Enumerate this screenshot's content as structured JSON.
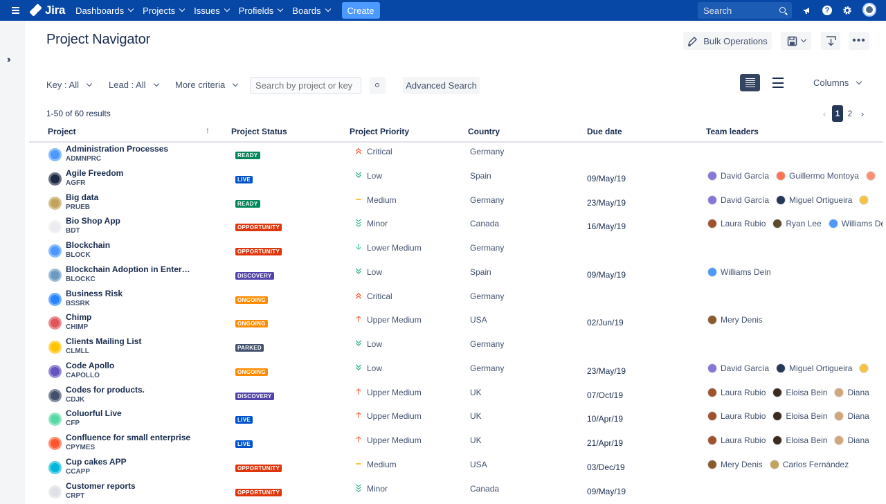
{
  "nav": {
    "logo": "Jira",
    "items": [
      "Dashboards",
      "Projects",
      "Issues",
      "Profields",
      "Boards"
    ],
    "create": "Create",
    "search_placeholder": "Search"
  },
  "page": {
    "title": "Project Navigator",
    "bulk_operations": "Bulk Operations"
  },
  "filters": {
    "key": "Key : All",
    "lead": "Lead : All",
    "more": "More criteria",
    "search_placeholder": "Search by project or key",
    "advanced": "Advanced Search",
    "columns": "Columns"
  },
  "results": "1-50 of 60 results",
  "pagination": {
    "current": "1",
    "next_page": "2"
  },
  "table": {
    "headers": {
      "project": "Project",
      "status": "Project Status",
      "priority": "Project Priority",
      "country": "Country",
      "due": "Due date",
      "leaders": "Team leaders"
    },
    "rows": [
      {
        "name": "Administration Processes",
        "key": "ADMNPRC",
        "status": "READY",
        "status_color": "#00875a",
        "priority": "Critical",
        "prio_type": "critical",
        "country": "Germany",
        "due": "",
        "icon_color": "#4c9aff",
        "leaders": []
      },
      {
        "name": "Agile Freedom",
        "key": "AGFR",
        "status": "LIVE",
        "status_color": "#0052cc",
        "priority": "Low",
        "prio_type": "low",
        "country": "Spain",
        "due": "09/May/19",
        "icon_color": "#1f2a44",
        "leaders": [
          {
            "name": "David García",
            "color": "#8777d9"
          },
          {
            "name": "Guillermo Montoya",
            "color": "#ff7452"
          },
          {
            "name": "",
            "color": "#ff8f73"
          }
        ]
      },
      {
        "name": "Big data",
        "key": "PRUEB",
        "status": "READY",
        "status_color": "#00875a",
        "priority": "Medium",
        "prio_type": "medium",
        "country": "Germany",
        "due": "23/May/19",
        "icon_color": "#c1a35a",
        "leaders": [
          {
            "name": "David García",
            "color": "#8777d9"
          },
          {
            "name": "Miguel Ortigueira",
            "color": "#253858"
          },
          {
            "name": "",
            "color": "#f6c343"
          }
        ]
      },
      {
        "name": "Bio Shop App",
        "key": "BDT",
        "status": "OPPORTUNITY",
        "status_color": "#de350b",
        "priority": "Minor",
        "prio_type": "minor",
        "country": "Canada",
        "due": "16/May/19",
        "icon_color": "#ebecf0",
        "leaders": [
          {
            "name": "Laura Rubio",
            "color": "#a0522d"
          },
          {
            "name": "Ryan Lee",
            "color": "#5e4a2e"
          },
          {
            "name": "Williams Dein",
            "color": "#4c9aff"
          }
        ]
      },
      {
        "name": "Blockchain",
        "key": "BLOCK",
        "status": "OPPORTUNITY",
        "status_color": "#de350b",
        "priority": "Lower Medium",
        "prio_type": "lower",
        "country": "Germany",
        "due": "",
        "icon_color": "#4c9aff",
        "leaders": []
      },
      {
        "name": "Blockchain Adoption in Enterprises",
        "key": "BLOCKC",
        "status": "DISCOVERY",
        "status_color": "#5243aa",
        "priority": "Low",
        "prio_type": "low",
        "country": "Spain",
        "due": "09/May/19",
        "icon_color": "#6b9bc3",
        "leaders": [
          {
            "name": "Williams Dein",
            "color": "#4c9aff"
          }
        ]
      },
      {
        "name": "Business Risk",
        "key": "BSSRK",
        "status": "ONGOING",
        "status_color": "#ff8b00",
        "priority": "Critical",
        "prio_type": "critical",
        "country": "Germany",
        "due": "",
        "icon_color": "#2684ff",
        "leaders": []
      },
      {
        "name": "Chimp",
        "key": "CHIMP",
        "status": "ONGOING",
        "status_color": "#ff8b00",
        "priority": "Upper Medium",
        "prio_type": "upper",
        "country": "USA",
        "due": "02/Jun/19",
        "icon_color": "#e0565b",
        "leaders": [
          {
            "name": "Mery Denis",
            "color": "#8b5a2b"
          }
        ]
      },
      {
        "name": "Clients Mailing List",
        "key": "CLMLL",
        "status": "PARKED",
        "status_color": "#42526e",
        "priority": "Low",
        "prio_type": "low",
        "country": "Germany",
        "due": "",
        "icon_color": "#ffc400",
        "leaders": []
      },
      {
        "name": "Code Apollo",
        "key": "CAPOLLO",
        "status": "ONGOING",
        "status_color": "#ff8b00",
        "priority": "Low",
        "prio_type": "low",
        "country": "Germany",
        "due": "23/May/19",
        "icon_color": "#6554c0",
        "leaders": [
          {
            "name": "David García",
            "color": "#8777d9"
          },
          {
            "name": "Miguel Ortigueira",
            "color": "#253858"
          },
          {
            "name": "",
            "color": "#f6c343"
          }
        ]
      },
      {
        "name": "Codes for products.",
        "key": "CDJK",
        "status": "DISCOVERY",
        "status_color": "#5243aa",
        "priority": "Upper Medium",
        "prio_type": "upper",
        "country": "UK",
        "due": "07/Oct/19",
        "icon_color": "#42526e",
        "leaders": [
          {
            "name": "Laura Rubio",
            "color": "#a0522d"
          },
          {
            "name": "Eloisa Bein",
            "color": "#3d2b1f"
          },
          {
            "name": "Diana",
            "color": "#d2a679"
          }
        ]
      },
      {
        "name": "Coluorful Live",
        "key": "CFP",
        "status": "LIVE",
        "status_color": "#0052cc",
        "priority": "Upper Medium",
        "prio_type": "upper",
        "country": "UK",
        "due": "10/Apr/19",
        "icon_color": "#57d9a3",
        "leaders": [
          {
            "name": "Laura Rubio",
            "color": "#a0522d"
          },
          {
            "name": "Eloisa Bein",
            "color": "#3d2b1f"
          },
          {
            "name": "Diana",
            "color": "#d2a679"
          }
        ]
      },
      {
        "name": "Confluence for small enterprise",
        "key": "CPYMES",
        "status": "LIVE",
        "status_color": "#0052cc",
        "priority": "Upper Medium",
        "prio_type": "upper",
        "country": "UK",
        "due": "21/Apr/19",
        "icon_color": "#ff5630",
        "leaders": [
          {
            "name": "Laura Rubio",
            "color": "#a0522d"
          },
          {
            "name": "Eloisa Bein",
            "color": "#3d2b1f"
          },
          {
            "name": "Diana",
            "color": "#d2a679"
          }
        ]
      },
      {
        "name": "Cup cakes APP",
        "key": "CCAPP",
        "status": "OPPORTUNITY",
        "status_color": "#de350b",
        "priority": "Medium",
        "prio_type": "medium",
        "country": "USA",
        "due": "03/Dec/19",
        "icon_color": "#00b8d9",
        "leaders": [
          {
            "name": "Mery Denis",
            "color": "#8b5a2b"
          },
          {
            "name": "Carlos Fernández",
            "color": "#c1a35a"
          }
        ]
      },
      {
        "name": "Customer reports",
        "key": "CRPT",
        "status": "OPPORTUNITY",
        "status_color": "#de350b",
        "priority": "Minor",
        "prio_type": "minor",
        "country": "Canada",
        "due": "09/May/19",
        "icon_color": "#dfe1e6",
        "leaders": []
      }
    ]
  }
}
